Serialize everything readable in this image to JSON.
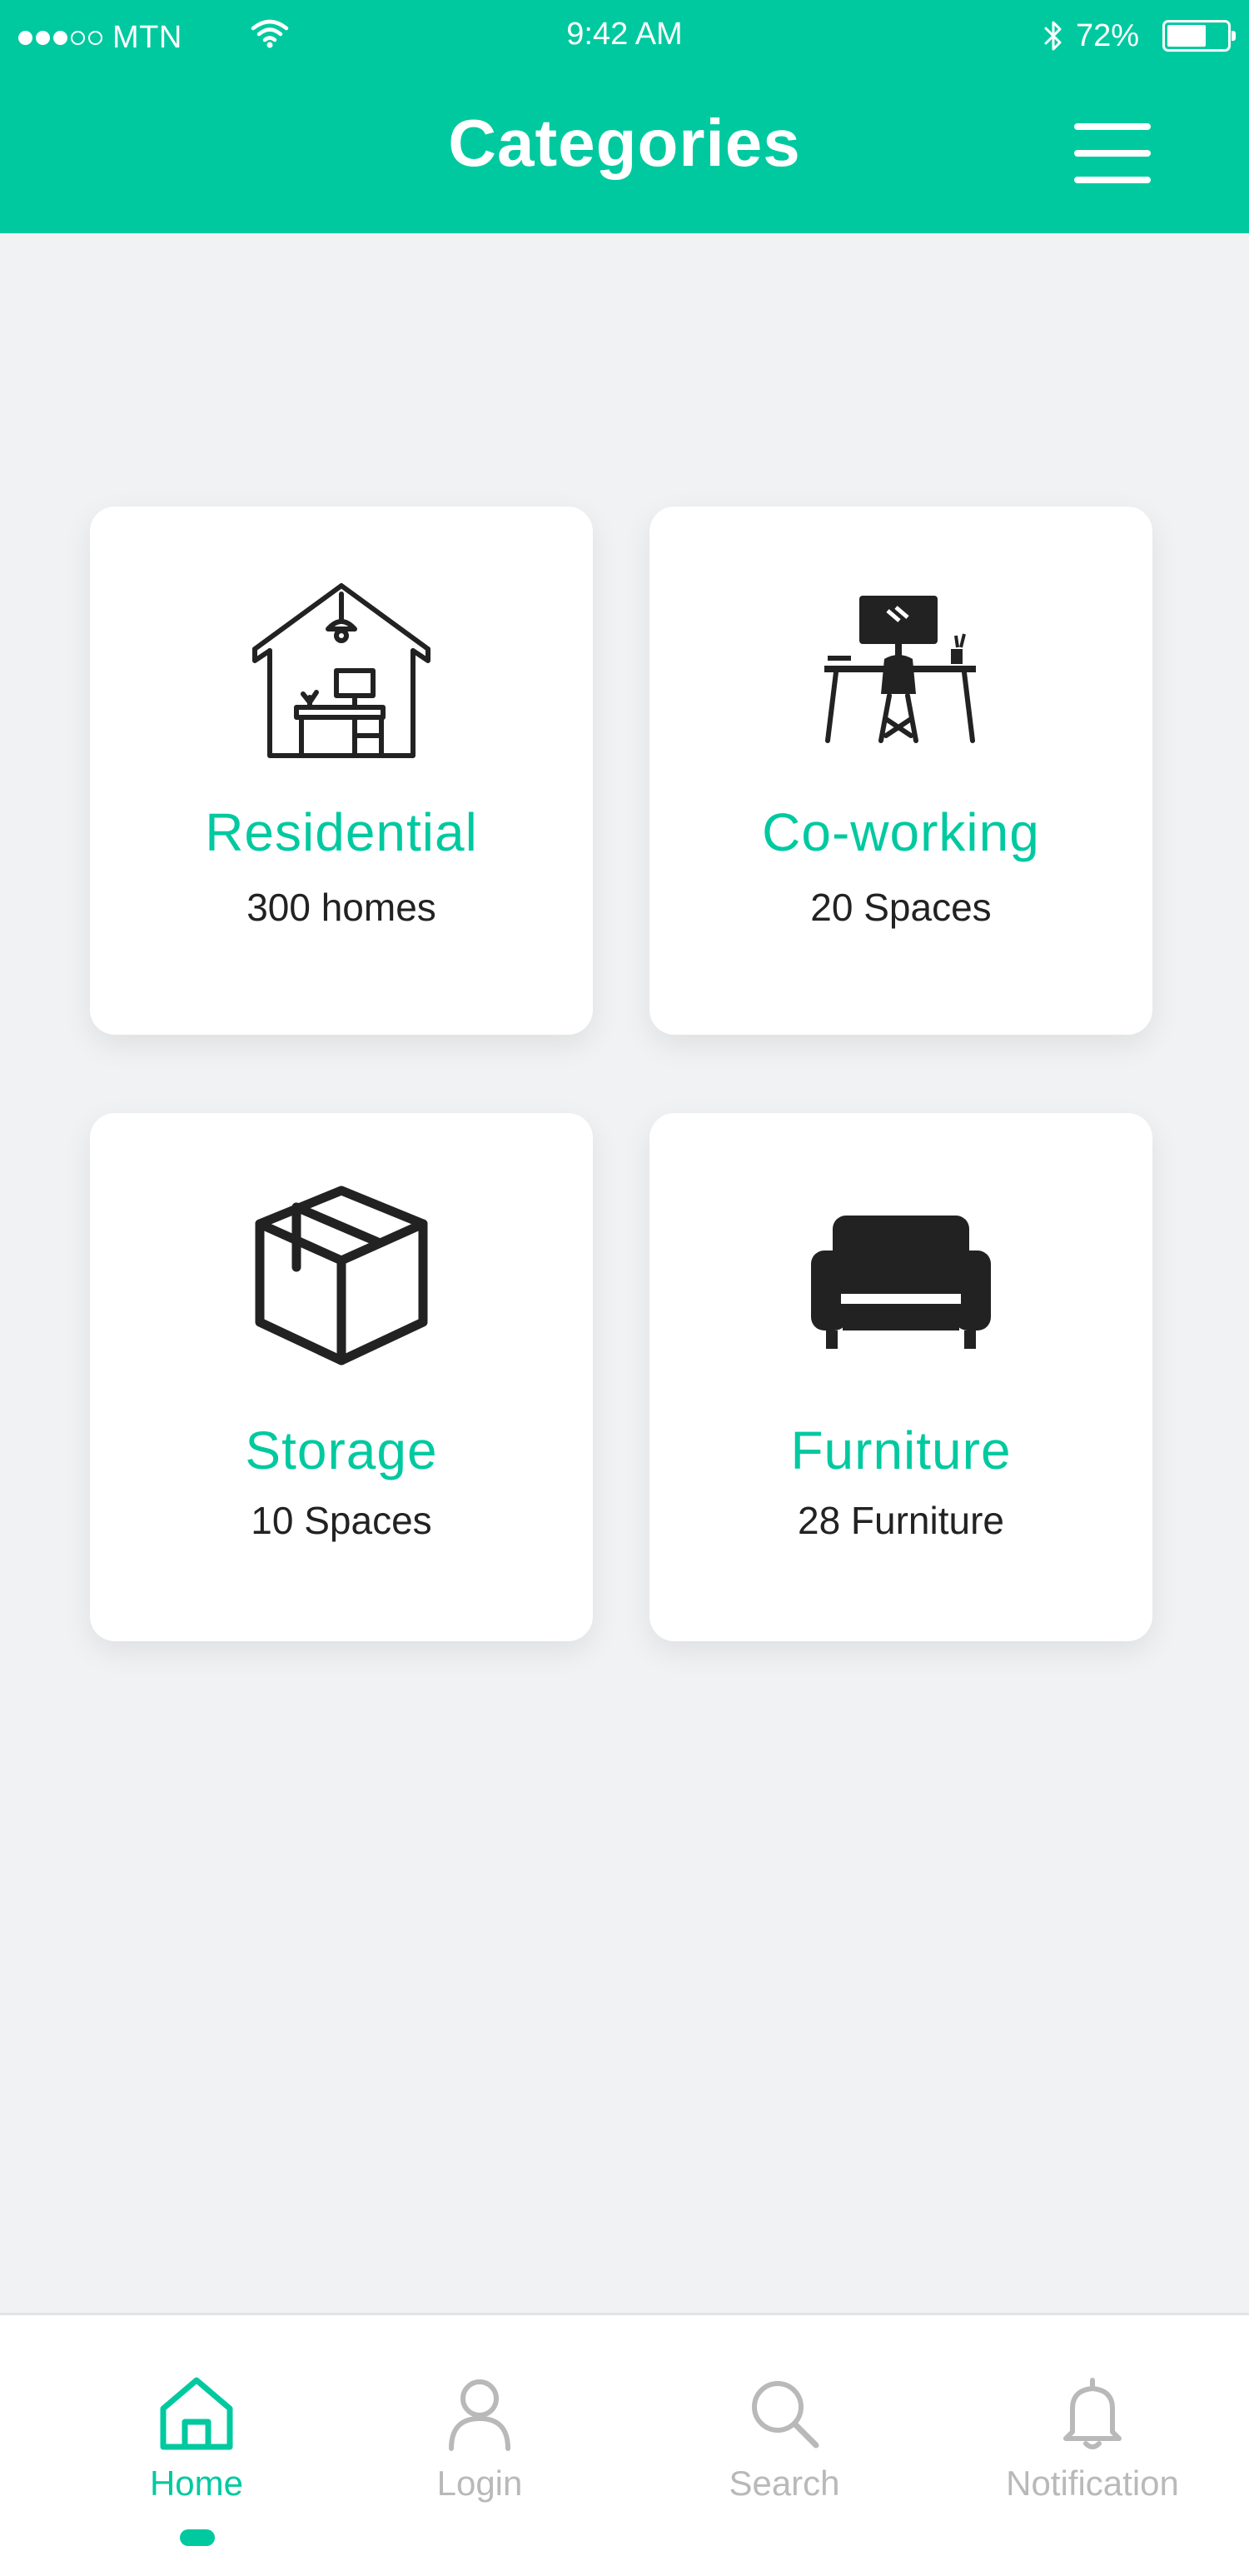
{
  "status_bar": {
    "carrier": "MTN",
    "time": "9:42 AM",
    "battery_percent": "72%",
    "battery_level": 0.72,
    "signal_bars_filled": 3,
    "signal_bars_total": 5
  },
  "header": {
    "title": "Categories",
    "menu_icon": "hamburger-menu-icon"
  },
  "categories": [
    {
      "title": "Residential",
      "subtitle": "300 homes",
      "icon": "house-office-icon"
    },
    {
      "title": "Co-working",
      "subtitle": "20 Spaces",
      "icon": "desk-workstation-icon"
    },
    {
      "title": "Storage",
      "subtitle": "10 Spaces",
      "icon": "box-icon"
    },
    {
      "title": "Furniture",
      "subtitle": "28 Furniture",
      "icon": "sofa-icon"
    }
  ],
  "bottom_nav": {
    "active": "Home",
    "items": [
      {
        "label": "Home",
        "icon": "home-icon"
      },
      {
        "label": "Login",
        "icon": "user-icon"
      },
      {
        "label": "Search",
        "icon": "search-icon"
      },
      {
        "label": "Notification",
        "icon": "bell-icon"
      }
    ]
  },
  "colors": {
    "accent": "#00c9a0",
    "background": "#f1f2f4",
    "card": "#ffffff",
    "text_dark": "#222222",
    "nav_inactive": "#b9b9b9"
  }
}
